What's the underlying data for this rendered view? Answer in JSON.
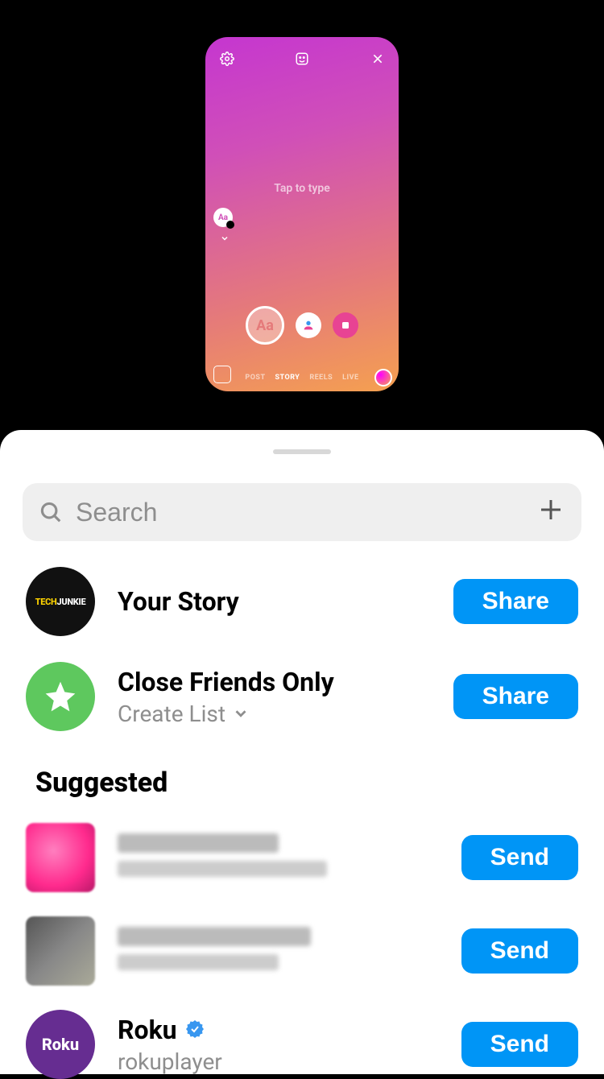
{
  "preview": {
    "prompt": "Tap to type",
    "text_badge": "Aa",
    "main_button": "Aa",
    "modes": {
      "post": "POST",
      "story": "STORY",
      "reels": "REELS",
      "live": "LIVE"
    }
  },
  "sheet": {
    "search_placeholder": "Search",
    "share_targets": [
      {
        "title": "Your Story",
        "action": "Share",
        "avatar": "techjunkie",
        "avatar_text_a": "TECH",
        "avatar_text_b": "JUNKIE"
      },
      {
        "title": "Close Friends Only",
        "subtitle": "Create List",
        "action": "Share",
        "avatar": "star"
      }
    ],
    "suggested_header": "Suggested",
    "suggested": [
      {
        "redacted": true,
        "action": "Send",
        "avatar": "blur1"
      },
      {
        "redacted": true,
        "action": "Send",
        "avatar": "blur2"
      },
      {
        "title": "Roku",
        "subtitle": "rokuplayer",
        "verified": true,
        "action": "Send",
        "avatar": "roku",
        "avatar_text": "Roku"
      }
    ]
  }
}
